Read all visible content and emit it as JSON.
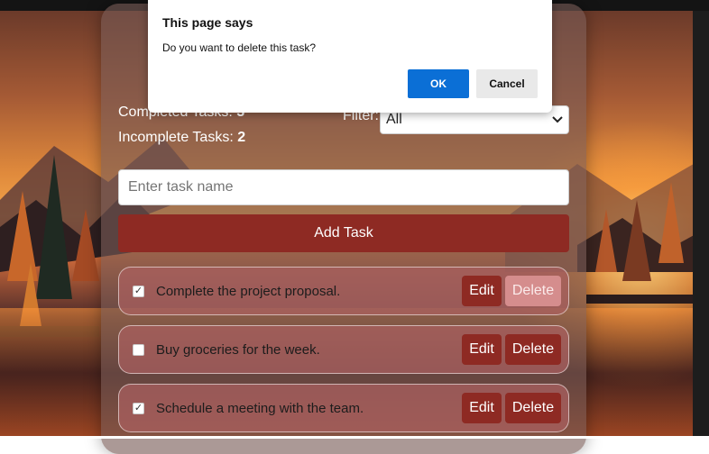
{
  "dialog": {
    "title": "This page says",
    "message": "Do you want to delete this task?",
    "ok_label": "OK",
    "cancel_label": "Cancel"
  },
  "stats": {
    "completed_label": "Completed Tasks:",
    "completed_count": "3",
    "incomplete_label": "Incomplete Tasks:",
    "incomplete_count": "2"
  },
  "filter": {
    "label": "Filter:",
    "selected": "All"
  },
  "new_task": {
    "placeholder": "Enter task name",
    "value": ""
  },
  "add_button_label": "Add Task",
  "tasks": [
    {
      "name": "Complete the project proposal.",
      "checked": true,
      "edit_label": "Edit",
      "delete_label": "Delete"
    },
    {
      "name": "Buy groceries for the week.",
      "checked": false,
      "edit_label": "Edit",
      "delete_label": "Delete"
    },
    {
      "name": "Schedule a meeting with the team.",
      "checked": true,
      "edit_label": "Edit",
      "delete_label": "Delete"
    }
  ],
  "colors": {
    "accent": "#8e2a23",
    "dialog_ok": "#0b6fd6"
  }
}
